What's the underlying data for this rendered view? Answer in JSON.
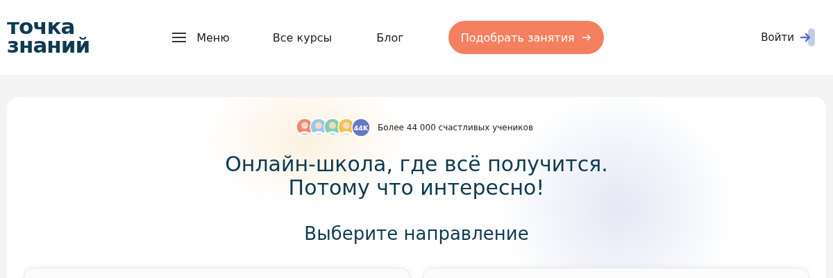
{
  "logo": {
    "line_1": "точка",
    "line_2": "знаний"
  },
  "nav": [
    {
      "label": "Меню",
      "kind": "menu"
    },
    {
      "label": "Все курсы",
      "kind": "link"
    },
    {
      "label": "Блог",
      "kind": "link"
    },
    {
      "label": "Подобрать занятия",
      "kind": "cta"
    }
  ],
  "login": {
    "label": "Войти"
  },
  "hero": {
    "avatars": [
      {
        "color": "#f08a6c"
      },
      {
        "color": "#9cc6e8"
      },
      {
        "color": "#7fcfb0"
      },
      {
        "color": "#f5c24c"
      }
    ],
    "count_badge": "44K",
    "students": "Более 44 000 счастливых учеников",
    "title_line_1": "Онлайн-школа, где всё получится.",
    "title_line_2": "Потому что интересно!",
    "subtitle": "Выберите направление"
  }
}
